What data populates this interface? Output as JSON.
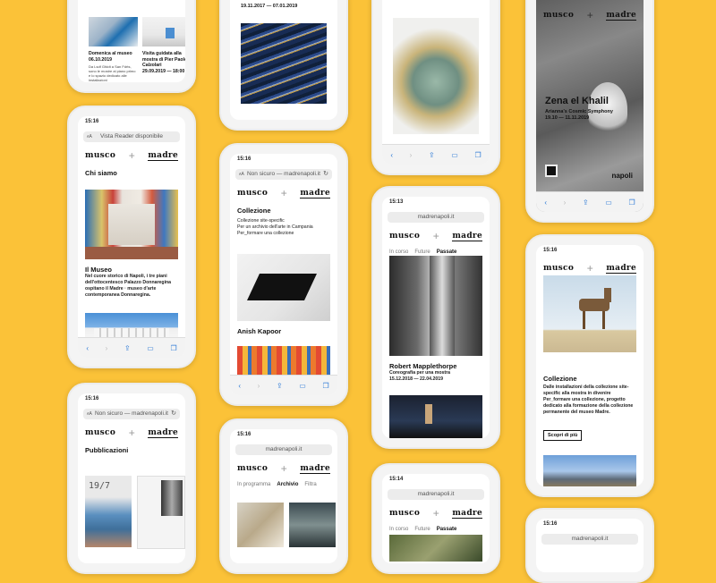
{
  "colors": {
    "background": "#fbc238",
    "phone": "#f4f4f4",
    "screen": "#ffffff",
    "link_blue": "#2d7ad6"
  },
  "phone1": {
    "items": [
      {
        "title": "Domenica al museo",
        "date": "06.10.2019",
        "text": "Da Lsdf Gfddt a San Fdrts, sono le mostre al piano primo e lo spazio dedicato alle installazioni"
      },
      {
        "title": "Visita guidata alla mostra di Pier Paolo Calzolari",
        "date": "29.09.2019 — 18:00"
      }
    ]
  },
  "phone2": {
    "time": "15:16",
    "reader": "Vista Reader disponibile",
    "logo_left": "musco",
    "logo_right": "madre",
    "heading": "Chi siamo",
    "section": "Il Museo",
    "body": "Nel cuore storico di Napoli, i tre piani dell'ottocentesco Palazzo Donnaregina ospitano il Madre · museo d'arte contemporanea Donnaregina."
  },
  "phone3": {
    "time": "15:16",
    "url": "Non sicuro — madrenapoli.it",
    "logo_left": "musco",
    "logo_right": "madre",
    "heading": "Pubblicazioni"
  },
  "phone4": {
    "date": "19.11.2017 — 07.01.2019"
  },
  "phone5": {
    "time": "15:16",
    "url": "Non sicuro — madrenapoli.it",
    "logo_left": "musco",
    "logo_right": "madre",
    "heading": "Collezione",
    "sub1": "Collezione site-specific",
    "sub2": "Per un archivio dell'arte in Campania",
    "sub3": "Per_formare una collezione",
    "artist": "Anish Kapoor"
  },
  "phone6": {
    "time": "15:16",
    "url": "madrenapoli.it",
    "logo_left": "musco",
    "logo_right": "madre",
    "tabs": [
      "In programma",
      "Archivio",
      "Filtra"
    ],
    "active_tab": "Archivio"
  },
  "phone7": {
    "time": "15:13",
    "url": "madrenapoli.it",
    "logo_left": "musco",
    "logo_right": "madre",
    "tabs": [
      "In corso",
      "Future",
      "Passate"
    ],
    "active_tab": "Passate",
    "artist": "Robert Mapplethorpe",
    "subtitle": "Coreografia per una mostra",
    "dates": "15.12.2018 — 22.04.2019"
  },
  "phone8": {
    "time": "15:14",
    "url": "madrenapoli.it",
    "logo_left": "musco",
    "logo_right": "madre",
    "tabs": [
      "In corso",
      "Future",
      "Passate"
    ],
    "active_tab": "Passate"
  },
  "phone9": {
    "logo_left": "musco",
    "logo_right": "madre",
    "artist": "Zena el Khalil",
    "show": "Arianna's Cosmic Symphony",
    "dates": "19.10 — 11.11.2019",
    "city": "napoli"
  },
  "phone10": {
    "time": "15:16",
    "url": "madrenapoli.it",
    "logo_left": "musco",
    "logo_right": "madre",
    "heading": "Collezione",
    "body": "Dalle installazioni della collezione site-specific alla mostra in divenire Per_formare una collezione, progetto dedicato alla formazione della collezione permanente del museo Madre.",
    "button": "Scopri di più"
  },
  "phone11": {
    "time": "15:16",
    "url": "madrenapoli.it"
  }
}
